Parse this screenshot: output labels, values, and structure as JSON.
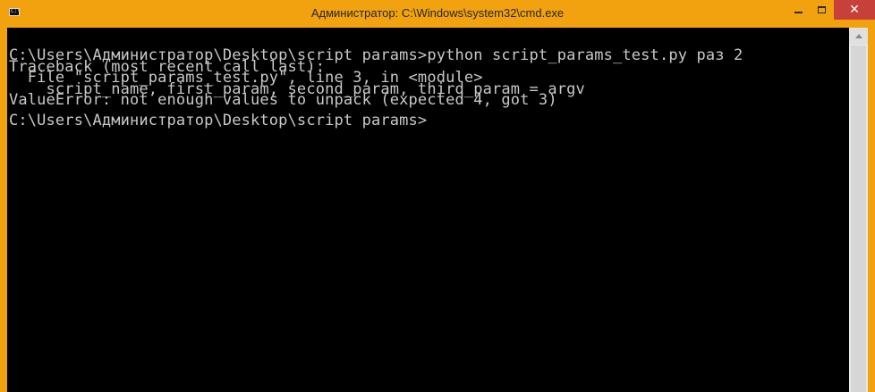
{
  "window": {
    "title": "Администратор: C:\\Windows\\system32\\cmd.exe",
    "accent_color": "#f2a20f",
    "close_color": "#c7413a",
    "app_icon": "cmd-app-icon",
    "app_icon_glyph": "C:\\"
  },
  "controls": {
    "minimize_icon": "minimize-icon",
    "maximize_icon": "maximize-icon",
    "close_icon": "close-icon",
    "close_glyph": "✕"
  },
  "console": {
    "background": "#000000",
    "foreground": "#c8c8c8",
    "line1": "C:\\Users\\Администратор\\Desktop\\script params>python script_params_test.py раз 2",
    "line2": "Traceback (most recent call last):",
    "line3": "  File \"script_params_test.py\", line 3, in <module>",
    "line4": "    script_name, first_param, second_param, third_param = argv",
    "line5": "ValueError: not enough values to unpack (expected 4, got 3)",
    "line6": "C:\\Users\\Администратор\\Desktop\\script params>"
  }
}
